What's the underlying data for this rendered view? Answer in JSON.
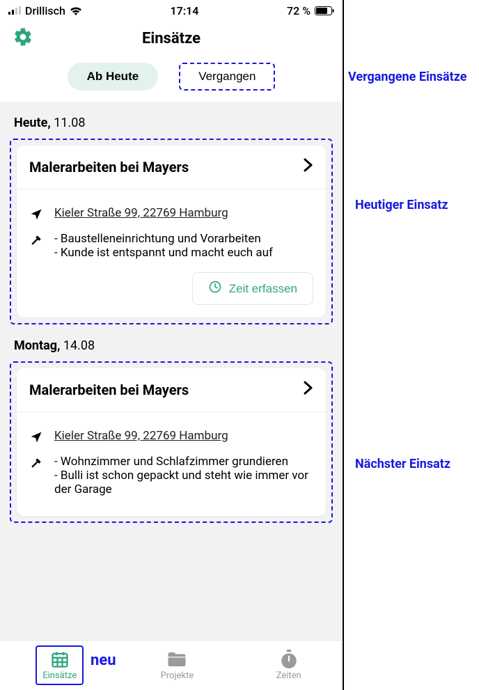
{
  "status_bar": {
    "carrier": "Drillisch",
    "time": "17:14",
    "battery_pct": "72 %"
  },
  "header": {
    "title": "Einsätze"
  },
  "segmented": {
    "today": "Ab Heute",
    "past": "Vergangen"
  },
  "days": [
    {
      "label_bold": "Heute,",
      "label_rest": " 11.08",
      "card": {
        "title": "Malerarbeiten bei Mayers",
        "address": "Kieler Straße 99, 22769  Hamburg",
        "notes": [
          "Baustelleneinrichtung und Vorarbeiten",
          "Kunde ist entspannt und macht euch auf"
        ],
        "time_btn": "Zeit erfassen"
      }
    },
    {
      "label_bold": "Montag,",
      "label_rest": " 14.08",
      "card": {
        "title": "Malerarbeiten bei Mayers",
        "address": "Kieler Straße 99, 22769  Hamburg",
        "notes": [
          "Wohnzimmer und Schlafzimmer grundieren",
          "Bulli ist schon gepackt und steht wie immer vor der Garage"
        ]
      }
    }
  ],
  "tabbar": {
    "einsaetze": "Einsätze",
    "projekte": "Projekte",
    "zeiten": "Zeiten"
  },
  "annotations": {
    "past": "Vergangene Einsätze",
    "today": "Heutiger Einsatz",
    "next": "Nächster Einsatz",
    "neu": "neu"
  },
  "colors": {
    "accent": "#2ea67a",
    "annotation": "#1818e0"
  }
}
